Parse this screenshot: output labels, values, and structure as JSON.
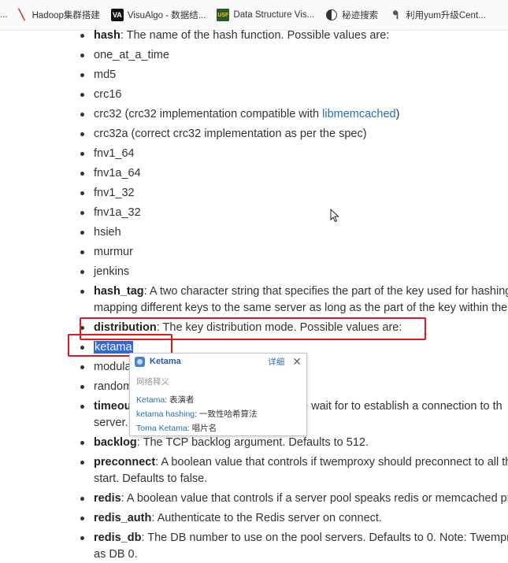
{
  "bookmarks": [
    {
      "label": "...",
      "icon": "none"
    },
    {
      "label": "Hadoop集群搭建",
      "icon": "hadoop-icon"
    },
    {
      "label": "VisuAlgo - 数据结...",
      "icon": "visualgo-icon"
    },
    {
      "label": "Data Structure Vis...",
      "icon": "usf-icon"
    },
    {
      "label": "秘迹搜索",
      "icon": "mijisousuo-icon"
    },
    {
      "label": "利用yum升级Cent...",
      "icon": "yum-icon"
    }
  ],
  "items": [
    {
      "key": "hash",
      "text": ": The name of the hash function. Possible values are:"
    },
    {
      "text": "one_at_a_time"
    },
    {
      "text": "md5"
    },
    {
      "text": "crc16"
    },
    {
      "text": "crc32 (crc32 implementation compatible with ",
      "link": "libmemcached",
      "after": ")"
    },
    {
      "text": "crc32a (correct crc32 implementation as per the spec)"
    },
    {
      "text": "fnv1_64"
    },
    {
      "text": "fnv1a_64"
    },
    {
      "text": "fnv1_32"
    },
    {
      "text": "fnv1a_32"
    },
    {
      "text": "hsieh"
    },
    {
      "text": "murmur"
    },
    {
      "text": "jenkins"
    },
    {
      "key": "hash_tag",
      "text": ": A two character string that specifies the part of the key used for hashing",
      "line2": "mapping different keys to the same server as long as the part of the key within the"
    },
    {
      "key": "distribution",
      "text": ": The key distribution mode. Possible values are:"
    },
    {
      "selected": "ketama"
    },
    {
      "text": "modula"
    },
    {
      "text": "random"
    },
    {
      "key": "timeout",
      "text": "e wait for to establish a connection to th",
      "line2": "server."
    },
    {
      "key": "backlog",
      "text": ": The TCP backlog argument. Defaults to 512."
    },
    {
      "key": "preconnect",
      "text": ": A boolean value that controls if twemproxy should preconnect to all th",
      "line2": "start. Defaults to false."
    },
    {
      "key": "redis",
      "text": ": A boolean value that controls if a server pool speaks redis or memcached pr"
    },
    {
      "key": "redis_auth",
      "text": ": Authenticate to the Redis server on connect."
    },
    {
      "key": "redis_db",
      "text": ": The DB number to use on the pool servers. Defaults to 0. Note: Twempro",
      "line2": "as DB 0."
    }
  ],
  "popup": {
    "title": "Ketama",
    "detail": "详细",
    "close": "✕",
    "section": "网络释义",
    "rows": [
      {
        "term": "Ketama",
        "sep": ": ",
        "meaning": "表演者"
      },
      {
        "term": "ketama hashing",
        "sep": ": ",
        "meaning": "一致性哈希算法"
      },
      {
        "term": "Toma Ketama",
        "sep": ": ",
        "meaning": "唱片名"
      }
    ]
  }
}
